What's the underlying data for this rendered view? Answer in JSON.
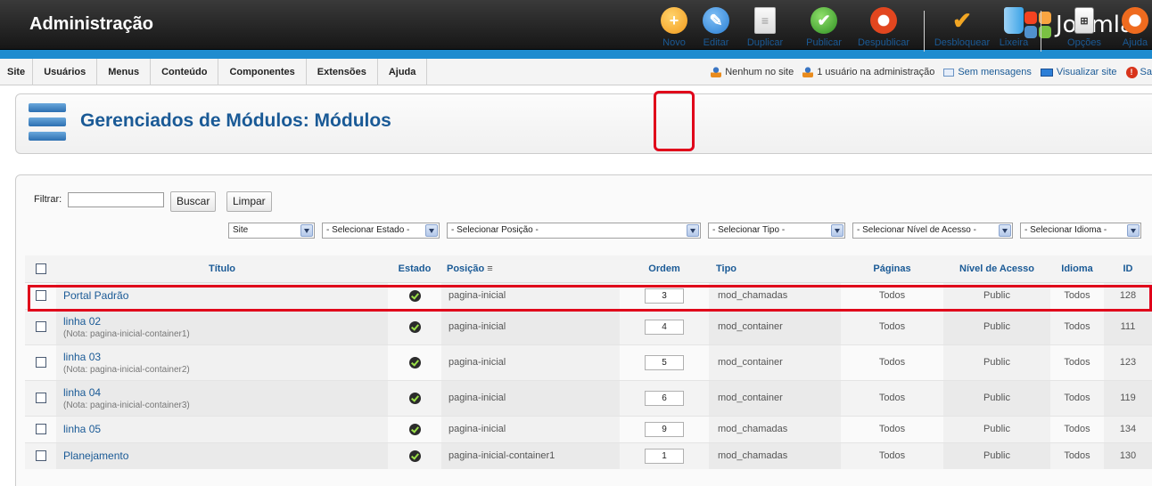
{
  "header": {
    "title": "Administração",
    "logo_text": "Joomla"
  },
  "menu": [
    "Site",
    "Usuários",
    "Menus",
    "Conteúdo",
    "Componentes",
    "Extensões",
    "Ajuda"
  ],
  "status": {
    "visitors": "Nenhum no site",
    "admins": "1 usuário na administração",
    "messages": "Sem mensagens",
    "view_site": "Visualizar site",
    "exit": "Sa"
  },
  "toolbar": {
    "page_title": "Gerenciados de Módulos: Módulos",
    "buttons": {
      "novo": "Novo",
      "editar": "Editar",
      "duplicar": "Duplicar",
      "publicar": "Publicar",
      "despublicar": "Despublicar",
      "desbloquear": "Desbloquear",
      "lixeira": "Lixeira",
      "opcoes": "Opções",
      "ajuda": "Ajuda"
    },
    "colors": {
      "novo": "#f39a1c",
      "editar": "#2a7fd4",
      "publicar": "#3c9a2a",
      "despublicar": "#e2461f",
      "desbloquear": "#f2a623",
      "lixeira": "#3aa2e6"
    }
  },
  "filter": {
    "label": "Filtrar:",
    "search_value": "",
    "buscar": "Buscar",
    "limpar": "Limpar",
    "selects": {
      "site": "Site",
      "estado": "- Selecionar Estado -",
      "posicao": "- Selecionar Posição -",
      "tipo": "- Selecionar Tipo -",
      "nivel": "- Selecionar Nível de Acesso -",
      "idioma": "- Selecionar Idioma -"
    }
  },
  "table": {
    "headers": {
      "titulo": "Título",
      "estado": "Estado",
      "posicao": "Posição",
      "ordem": "Ordem",
      "tipo": "Tipo",
      "paginas": "Páginas",
      "nivel": "Nível de Acesso",
      "idioma": "Idioma",
      "id": "ID"
    },
    "rows": [
      {
        "title": "Portal Padrão",
        "note_label": "",
        "note_value": "",
        "position": "pagina-inicial",
        "order": "3",
        "type": "mod_chamadas",
        "pages": "Todos",
        "access": "Public",
        "language": "Todos",
        "id": "128"
      },
      {
        "title": "linha 02",
        "note_label": "Nota",
        "note_value": ": pagina-inicial-container1)",
        "position": "pagina-inicial",
        "order": "4",
        "type": "mod_container",
        "pages": "Todos",
        "access": "Public",
        "language": "Todos",
        "id": "111"
      },
      {
        "title": "linha 03",
        "note_label": "Nota",
        "note_value": ": pagina-inicial-container2)",
        "position": "pagina-inicial",
        "order": "5",
        "type": "mod_container",
        "pages": "Todos",
        "access": "Public",
        "language": "Todos",
        "id": "123"
      },
      {
        "title": "linha 04",
        "note_label": "Nota",
        "note_value": ": pagina-inicial-container3)",
        "position": "pagina-inicial",
        "order": "6",
        "type": "mod_container",
        "pages": "Todos",
        "access": "Public",
        "language": "Todos",
        "id": "119"
      },
      {
        "title": "linha 05",
        "note_label": "",
        "note_value": "",
        "position": "pagina-inicial",
        "order": "9",
        "type": "mod_chamadas",
        "pages": "Todos",
        "access": "Public",
        "language": "Todos",
        "id": "134"
      },
      {
        "title": "Planejamento",
        "note_label": "",
        "note_value": "",
        "position": "pagina-inicial-container1",
        "order": "1",
        "type": "mod_chamadas",
        "pages": "Todos",
        "access": "Public",
        "language": "Todos",
        "id": "130"
      }
    ]
  }
}
